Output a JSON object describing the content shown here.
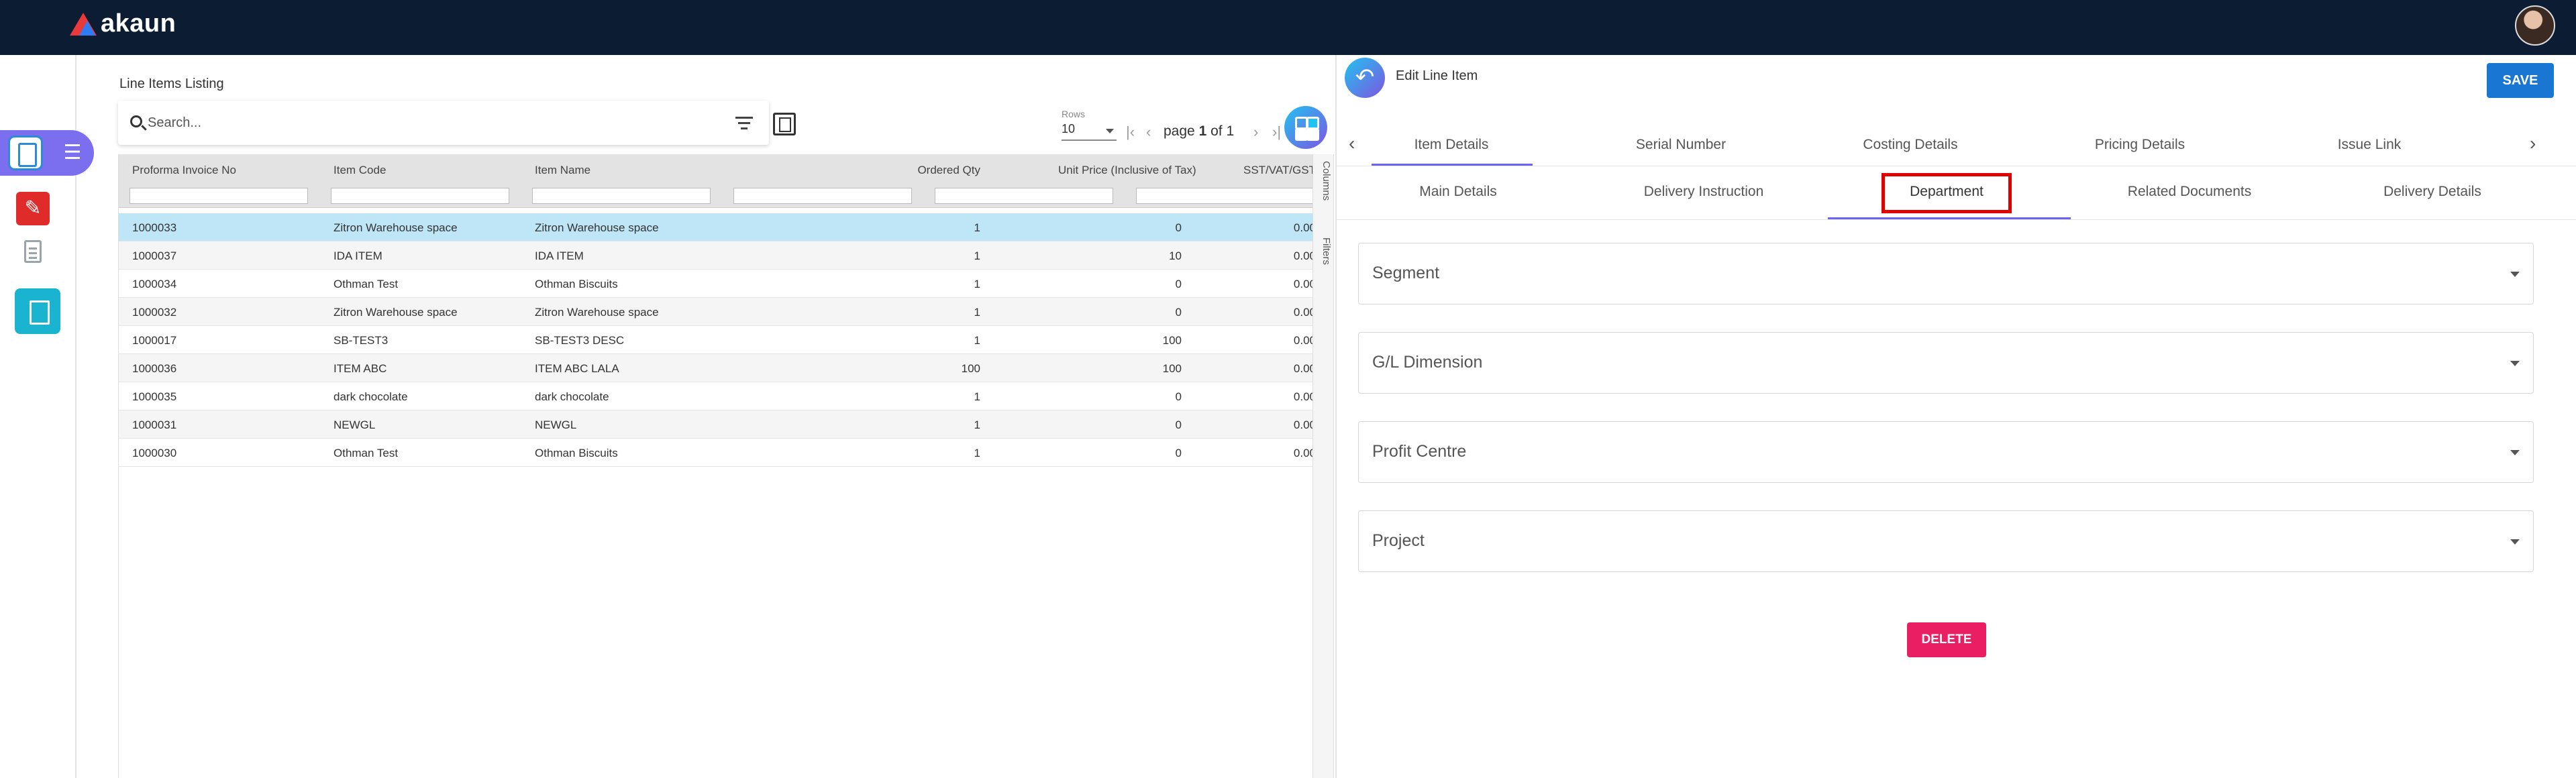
{
  "app": {
    "brand": "akaun"
  },
  "listing": {
    "title": "Line Items Listing",
    "search_placeholder": "Search...",
    "rows_label": "Rows",
    "rows_value": "10",
    "page_word": "page",
    "page_current": "1",
    "page_of": "of",
    "page_total": "1",
    "columns_tab": "Columns",
    "filters_tab": "Filters",
    "columns": [
      "Proforma Invoice No",
      "Item Code",
      "Item Name",
      "Ordered Qty",
      "Unit Price (Inclusive of Tax)",
      "SST/VAT/GST"
    ],
    "rows": [
      {
        "invoice": "1000033",
        "code": "Zitron Warehouse space",
        "name": "Zitron Warehouse space",
        "qty": "1",
        "price": "0",
        "tax": "0.00"
      },
      {
        "invoice": "1000037",
        "code": "IDA ITEM",
        "name": "IDA ITEM",
        "qty": "1",
        "price": "10",
        "tax": "0.00"
      },
      {
        "invoice": "1000034",
        "code": "Othman Test",
        "name": "Othman Biscuits",
        "qty": "1",
        "price": "0",
        "tax": "0.00"
      },
      {
        "invoice": "1000032",
        "code": "Zitron Warehouse space",
        "name": "Zitron Warehouse space",
        "qty": "1",
        "price": "0",
        "tax": "0.00"
      },
      {
        "invoice": "1000017",
        "code": "SB-TEST3",
        "name": "SB-TEST3 DESC",
        "qty": "1",
        "price": "100",
        "tax": "0.00"
      },
      {
        "invoice": "1000036",
        "code": "ITEM ABC",
        "name": "ITEM ABC LALA",
        "qty": "100",
        "price": "100",
        "tax": "0.00"
      },
      {
        "invoice": "1000035",
        "code": "dark chocolate",
        "name": "dark chocolate",
        "qty": "1",
        "price": "0",
        "tax": "0.00"
      },
      {
        "invoice": "1000031",
        "code": "NEWGL",
        "name": "NEWGL",
        "qty": "1",
        "price": "0",
        "tax": "0.00"
      },
      {
        "invoice": "1000030",
        "code": "Othman Test",
        "name": "Othman Biscuits",
        "qty": "1",
        "price": "0",
        "tax": "0.00"
      }
    ]
  },
  "editor": {
    "title": "Edit Line Item",
    "save_label": "SAVE",
    "tabs": [
      "Item Details",
      "Serial Number",
      "Costing Details",
      "Pricing Details",
      "Issue Link"
    ],
    "subtabs": [
      "Main Details",
      "Delivery Instruction",
      "Department",
      "Related Documents",
      "Delivery Details"
    ],
    "fields": [
      "Segment",
      "G/L Dimension",
      "Profit Centre",
      "Project"
    ],
    "delete_label": "DELETE"
  },
  "colors": {
    "topbar": "#0b1c33",
    "accent": "#6c63f0",
    "save": "#1976d2",
    "delete": "#e91e63",
    "selected_row": "#bfe6f7",
    "highlight": "#e00000"
  }
}
